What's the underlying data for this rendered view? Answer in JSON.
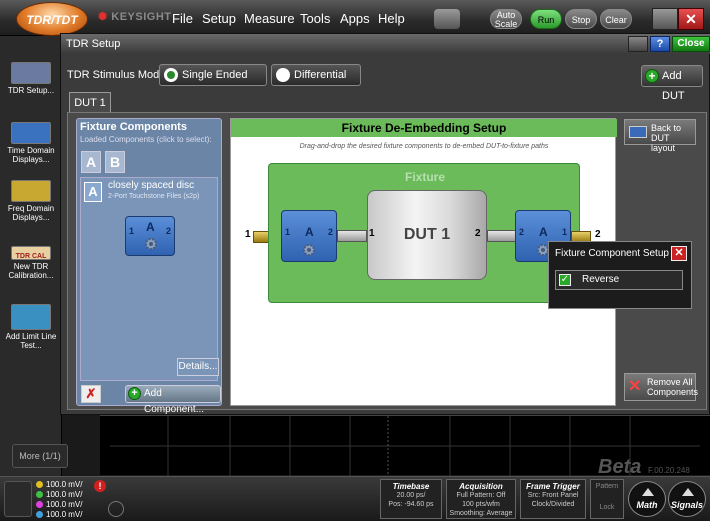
{
  "menubar": {
    "app_badge": "TDR/TDT",
    "logo": "KEYSIGHT",
    "items": [
      "File",
      "Setup",
      "Measure",
      "Tools",
      "Apps",
      "Help"
    ],
    "auto_scale": "Auto Scale",
    "run": "Run",
    "stop": "Stop",
    "clear": "Clear"
  },
  "sidebar": {
    "items": [
      {
        "label": "TDR Setup..."
      },
      {
        "label": "Time Domain Displays..."
      },
      {
        "label": "Freq Domain Displays..."
      },
      {
        "label": "New TDR Calibration..."
      },
      {
        "label": "Add Limit Line Test..."
      }
    ],
    "tdr_cal_badge": "TDR CAL",
    "more": "More (1/1)"
  },
  "dialog": {
    "title": "TDR Setup",
    "help": "?",
    "close": "Close",
    "stimulus_label": "TDR Stimulus Mode:",
    "modes": [
      "Single Ended",
      "Differential"
    ],
    "selected_mode": "Single Ended",
    "add_dut": "Add DUT",
    "tab": "DUT 1",
    "fixture_components": {
      "title": "Fixture Components",
      "subtitle": "Loaded Components (click to select):",
      "slots": [
        "A",
        "B"
      ],
      "item_badge": "A",
      "item_name": "closely spaced disc",
      "item_type": "2-Port Touchstone Files (s2p)",
      "block": {
        "label": "A",
        "port1": "1",
        "port2": "2"
      },
      "details": "Details...",
      "delete": "✗",
      "add_component": "Add Component..."
    },
    "deembed": {
      "title": "Fixture De-Embedding Setup",
      "hint": "Drag-and-drop the desired fixture components to de-embed DUT-to-fixture paths",
      "fixture_label": "Fixture",
      "dut_label": "DUT 1",
      "left_block": {
        "label": "A",
        "port1": "1",
        "port2": "2"
      },
      "right_block": {
        "label": "A",
        "port1": "2",
        "port2": "1"
      },
      "outer_left_port": "1",
      "outer_right_port": "2",
      "dut_port_left": "1",
      "dut_port_right": "2"
    },
    "back_to_dut": "Back to DUT layout",
    "remove_all": "Remove All Components"
  },
  "popup": {
    "title": "Fixture Component Setup",
    "close": "✕",
    "reverse_label": "Reverse",
    "reverse_checked": true
  },
  "statusbar": {
    "channels": [
      {
        "value": "100.0 mV/",
        "color": "#e0c020"
      },
      {
        "value": "100.0 mV/",
        "color": "#40c040"
      },
      {
        "value": "100.0 mV/",
        "color": "#e040e0"
      },
      {
        "value": "100.0 mV/",
        "color": "#40a0e0"
      }
    ],
    "timebase": {
      "title": "Timebase",
      "line1": "20.00 ps/",
      "line2": "Pos: -94.60 ps"
    },
    "acquisition": {
      "title": "Acquisition",
      "line1": "Full Pattern: Off",
      "line2": "100 pts/wfm",
      "line3": "Smoothing: Average"
    },
    "frame_trigger": {
      "title": "Frame Trigger",
      "line1": "Src: Front Panel",
      "line2": "Clock/Divided"
    },
    "pattern": {
      "title": "Pattern",
      "lock": "Lock"
    },
    "math": "Math",
    "signals": "Signals",
    "beta": "Beta",
    "beta_version": "F.00.20.248"
  },
  "colors": {
    "accent_green": "#6cbb5a",
    "component_blue": "#3f73c4",
    "close_red": "#c82222"
  }
}
